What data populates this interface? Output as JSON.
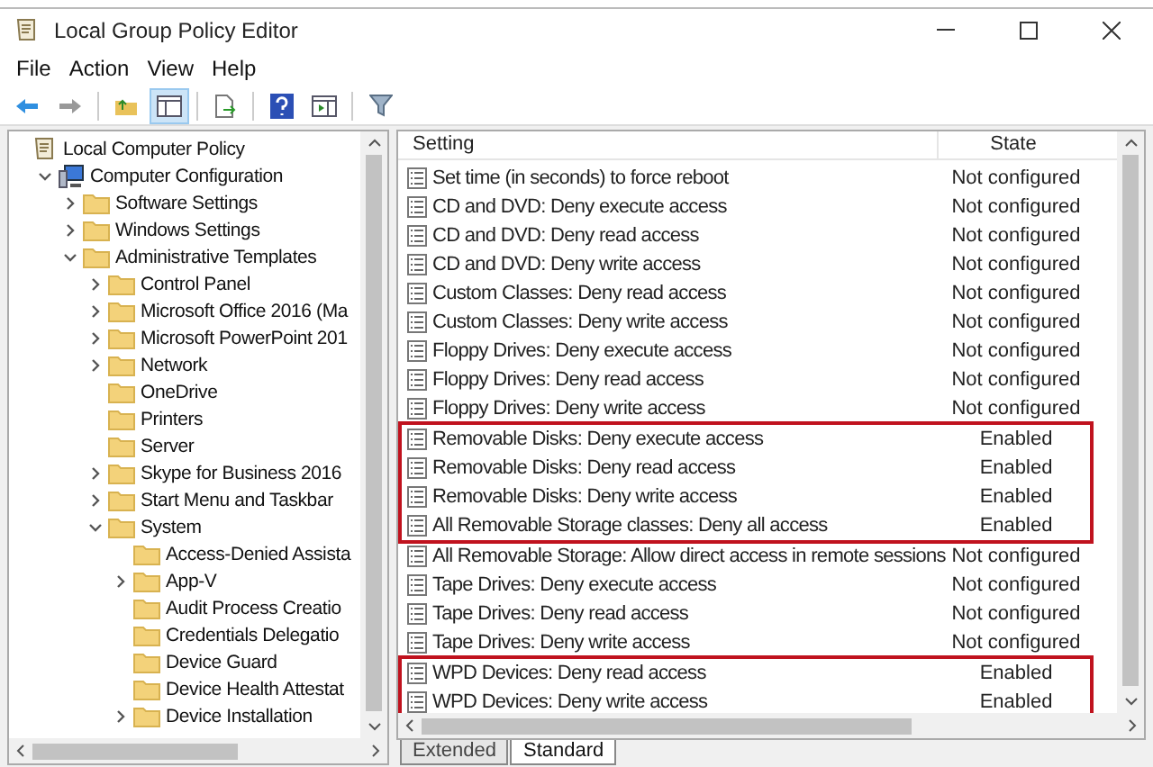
{
  "window": {
    "title": "Local Group Policy Editor"
  },
  "menu": [
    "File",
    "Action",
    "View",
    "Help"
  ],
  "tree": [
    {
      "label": "Local Computer Policy",
      "kind": "root",
      "children": [
        {
          "label": "Computer Configuration",
          "kind": "computer",
          "expanded": true,
          "children": [
            {
              "label": "Software Settings",
              "kind": "branch",
              "expanded": false
            },
            {
              "label": "Windows Settings",
              "kind": "branch",
              "expanded": false
            },
            {
              "label": "Administrative Templates",
              "kind": "branch",
              "expanded": true,
              "children": [
                {
                  "label": "Control Panel",
                  "kind": "branch",
                  "expanded": false
                },
                {
                  "label": "Microsoft Office 2016 (Ma",
                  "kind": "branch",
                  "expanded": false
                },
                {
                  "label": "Microsoft PowerPoint 201",
                  "kind": "branch",
                  "expanded": false
                },
                {
                  "label": "Network",
                  "kind": "branch",
                  "expanded": false
                },
                {
                  "label": "OneDrive",
                  "kind": "leaf",
                  "expanded": false
                },
                {
                  "label": "Printers",
                  "kind": "leaf",
                  "expanded": false
                },
                {
                  "label": "Server",
                  "kind": "leaf",
                  "expanded": false
                },
                {
                  "label": "Skype for Business 2016",
                  "kind": "branch",
                  "expanded": false
                },
                {
                  "label": "Start Menu and Taskbar",
                  "kind": "branch",
                  "expanded": false
                },
                {
                  "label": "System",
                  "kind": "branch",
                  "expanded": true,
                  "children": [
                    {
                      "label": "Access-Denied Assista",
                      "kind": "leaf",
                      "expanded": false
                    },
                    {
                      "label": "App-V",
                      "kind": "branch",
                      "expanded": false
                    },
                    {
                      "label": "Audit Process Creatio",
                      "kind": "leaf",
                      "expanded": false
                    },
                    {
                      "label": "Credentials Delegatio",
                      "kind": "leaf",
                      "expanded": false
                    },
                    {
                      "label": "Device Guard",
                      "kind": "leaf",
                      "expanded": false
                    },
                    {
                      "label": "Device Health Attestat",
                      "kind": "leaf",
                      "expanded": false
                    },
                    {
                      "label": "Device Installation",
                      "kind": "branch",
                      "expanded": false
                    }
                  ]
                }
              ]
            }
          ]
        }
      ]
    }
  ],
  "table": {
    "columns": [
      "Setting",
      "State"
    ],
    "groups": [
      {
        "highlighted": false,
        "rows": [
          {
            "setting": "Set time (in seconds) to force reboot",
            "state": "Not configured"
          },
          {
            "setting": "CD and DVD: Deny execute access",
            "state": "Not configured"
          },
          {
            "setting": "CD and DVD: Deny read access",
            "state": "Not configured"
          },
          {
            "setting": "CD and DVD: Deny write access",
            "state": "Not configured"
          },
          {
            "setting": "Custom Classes: Deny read access",
            "state": "Not configured"
          },
          {
            "setting": "Custom Classes: Deny write access",
            "state": "Not configured"
          },
          {
            "setting": "Floppy Drives: Deny execute access",
            "state": "Not configured"
          },
          {
            "setting": "Floppy Drives: Deny read access",
            "state": "Not configured"
          },
          {
            "setting": "Floppy Drives: Deny write access",
            "state": "Not configured"
          }
        ]
      },
      {
        "highlighted": true,
        "rows": [
          {
            "setting": "Removable Disks: Deny execute access",
            "state": "Enabled"
          },
          {
            "setting": "Removable Disks: Deny read access",
            "state": "Enabled"
          },
          {
            "setting": "Removable Disks: Deny write access",
            "state": "Enabled"
          },
          {
            "setting": "All Removable Storage classes: Deny all access",
            "state": "Enabled"
          }
        ]
      },
      {
        "highlighted": false,
        "rows": [
          {
            "setting": "All Removable Storage: Allow direct access in remote sessions",
            "state": "Not configured"
          },
          {
            "setting": "Tape Drives: Deny execute access",
            "state": "Not configured"
          },
          {
            "setting": "Tape Drives: Deny read access",
            "state": "Not configured"
          },
          {
            "setting": "Tape Drives: Deny write access",
            "state": "Not configured"
          }
        ]
      },
      {
        "highlighted": true,
        "rows": [
          {
            "setting": "WPD Devices: Deny read access",
            "state": "Enabled"
          },
          {
            "setting": "WPD Devices: Deny write access",
            "state": "Enabled"
          }
        ]
      }
    ]
  },
  "view_tabs": [
    {
      "label": "Extended",
      "selected": false
    },
    {
      "label": "Standard",
      "selected": true
    }
  ]
}
